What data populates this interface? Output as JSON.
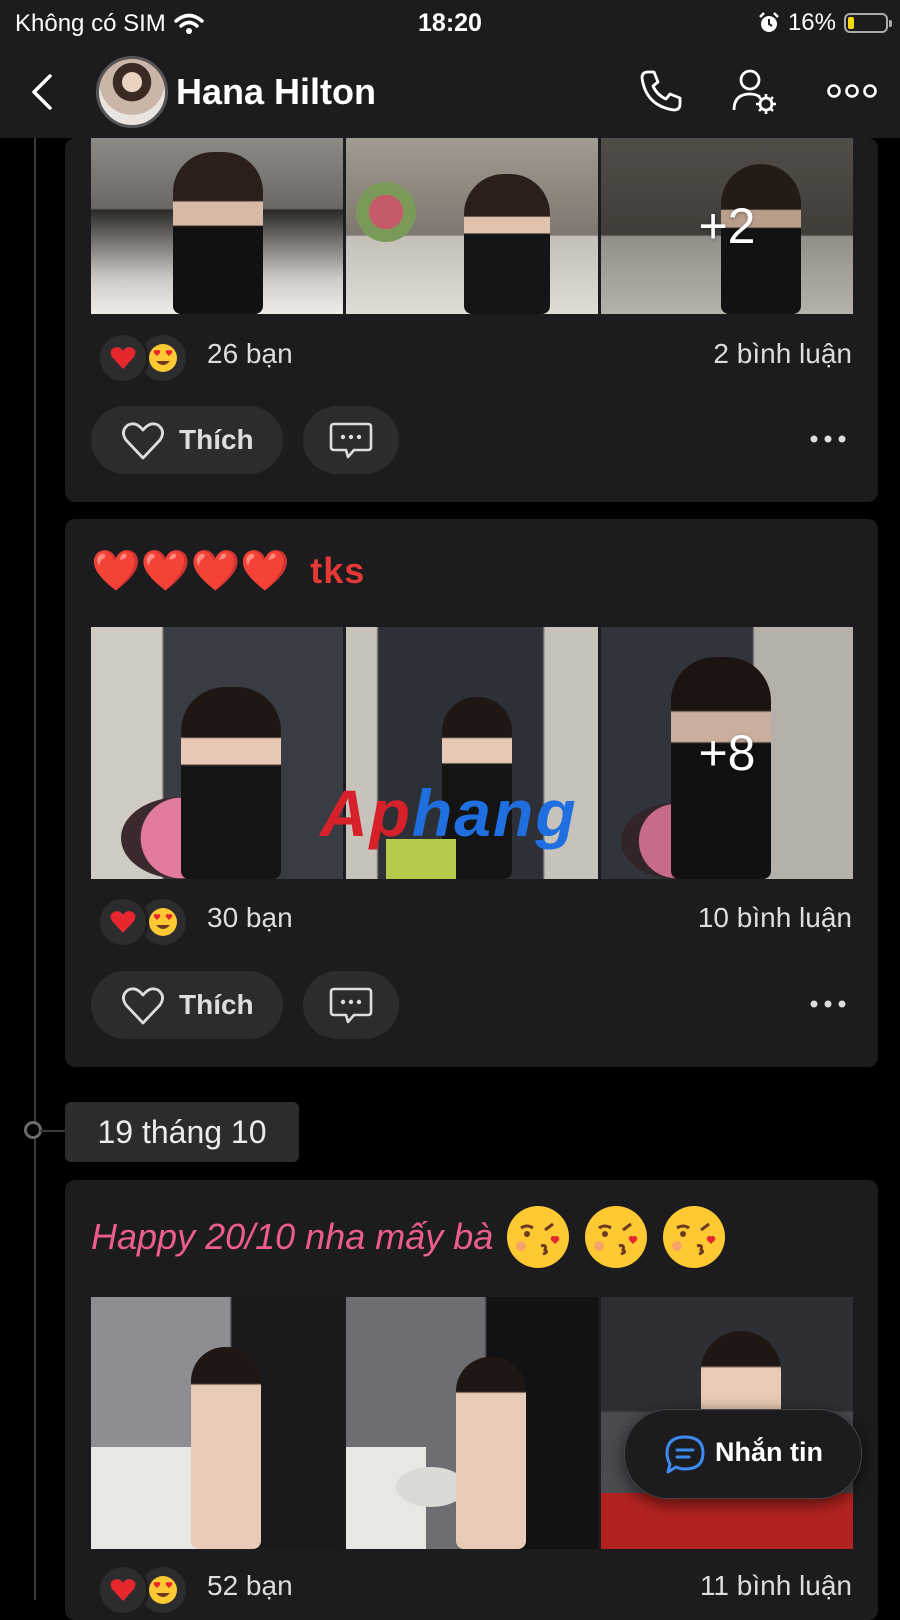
{
  "status_bar": {
    "carrier": "Không có SIM",
    "time": "18:20",
    "battery_pct": "16%"
  },
  "header": {
    "name": "Hana Hilton"
  },
  "posts": [
    {
      "caption": "",
      "more_photos": "+2",
      "reaction_count": "26 bạn",
      "comment_count": "2 bình luận",
      "like_label": "Thích"
    },
    {
      "caption": "❤️❤️❤️❤️",
      "caption_suffix": "tks",
      "more_photos": "+8",
      "reaction_count": "30 bạn",
      "comment_count": "10 bình luận",
      "like_label": "Thích"
    },
    {
      "caption": "Happy 20/10 nha mấy bà",
      "reaction_count": "52 bạn",
      "comment_count": "11 bình luận"
    }
  ],
  "date_separator": "19 tháng 10",
  "message_button": {
    "label": "Nhắn tin"
  },
  "watermark": {
    "part1": "Ap",
    "part2": "hang"
  },
  "colors": {
    "background": "#000000",
    "card": "#1c1c1e",
    "caption_red": "#e53935",
    "caption_pink": "#ec5d8e",
    "battery_low": "#f5d90a"
  }
}
